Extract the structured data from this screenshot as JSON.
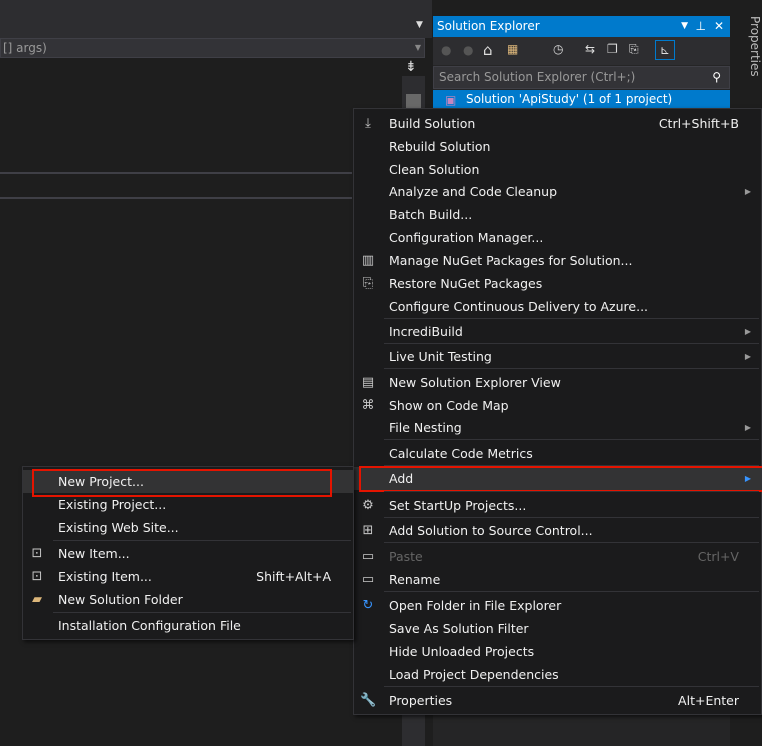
{
  "editor": {
    "signature": "[] args)"
  },
  "solution_explorer": {
    "title": "Solution Explorer",
    "search_placeholder": "Search Solution Explorer (Ctrl+;)",
    "selected_node": "Solution 'ApiStudy' (1 of 1 project)"
  },
  "properties_tab": "Properties",
  "context_menu": {
    "items": [
      {
        "label": "Build Solution",
        "shortcut": "Ctrl+Shift+B",
        "icon": "build-icon"
      },
      {
        "label": "Rebuild Solution"
      },
      {
        "label": "Clean Solution"
      },
      {
        "label": "Analyze and Code Cleanup",
        "submenu": true
      },
      {
        "label": "Batch Build..."
      },
      {
        "label": "Configuration Manager..."
      },
      {
        "label": "Manage NuGet Packages for Solution...",
        "icon": "nuget-icon"
      },
      {
        "label": "Restore NuGet Packages",
        "icon": "restore-icon"
      },
      {
        "label": "Configure Continuous Delivery to Azure..."
      },
      {
        "label": "IncrediBuild",
        "submenu": true
      },
      {
        "label": "Live Unit Testing",
        "submenu": true
      },
      {
        "label": "New Solution Explorer View",
        "icon": "new-view-icon"
      },
      {
        "label": "Show on Code Map",
        "icon": "code-map-icon"
      },
      {
        "label": "File Nesting",
        "submenu": true
      },
      {
        "label": "Calculate Code Metrics"
      },
      {
        "label": "Add",
        "submenu": true,
        "highlighted": true
      },
      {
        "label": "Set StartUp Projects...",
        "icon": "gear-icon"
      },
      {
        "label": "Add Solution to Source Control...",
        "icon": "source-control-icon"
      },
      {
        "label": "Paste",
        "shortcut": "Ctrl+V",
        "disabled": true,
        "icon": "paste-icon"
      },
      {
        "label": "Rename",
        "icon": "rename-icon"
      },
      {
        "label": "Open Folder in File Explorer",
        "icon": "open-folder-icon"
      },
      {
        "label": "Save As Solution Filter"
      },
      {
        "label": "Hide Unloaded Projects"
      },
      {
        "label": "Load Project Dependencies"
      },
      {
        "label": "Properties",
        "shortcut": "Alt+Enter",
        "icon": "wrench-icon"
      }
    ]
  },
  "add_submenu": {
    "items": [
      {
        "label": "New Project...",
        "highlighted": true
      },
      {
        "label": "Existing Project..."
      },
      {
        "label": "Existing Web Site..."
      },
      {
        "label": "New Item...",
        "icon": "new-item-icon"
      },
      {
        "label": "Existing Item...",
        "shortcut": "Shift+Alt+A",
        "icon": "existing-item-icon"
      },
      {
        "label": "New Solution Folder",
        "icon": "new-folder-icon"
      },
      {
        "label": "Installation Configuration File"
      }
    ]
  },
  "colors": {
    "accent": "#007acc",
    "highlight_box": "#e51400"
  }
}
